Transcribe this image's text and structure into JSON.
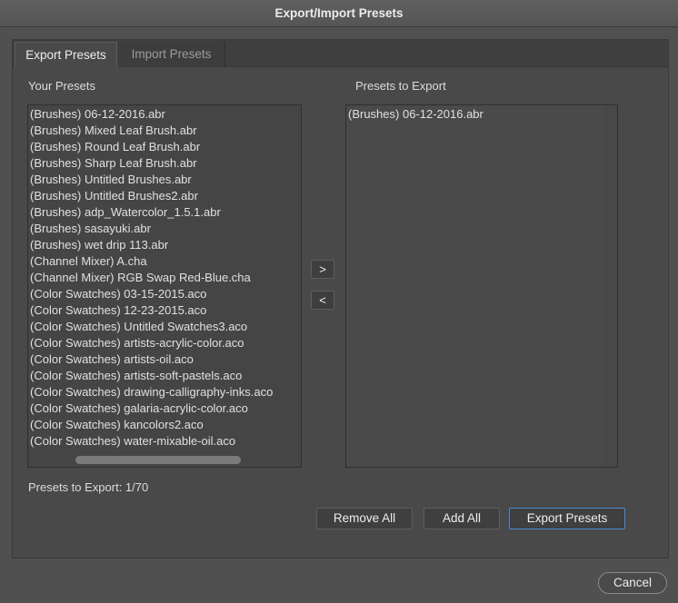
{
  "window": {
    "title": "Export/Import Presets"
  },
  "tabs": [
    {
      "label": "Export Presets",
      "active": true
    },
    {
      "label": "Import Presets",
      "active": false
    }
  ],
  "left_panel": {
    "label": "Your Presets",
    "items": [
      "(Brushes)  06-12-2016.abr",
      "(Brushes)  Mixed Leaf Brush.abr",
      "(Brushes)  Round Leaf Brush.abr",
      "(Brushes)  Sharp Leaf Brush.abr",
      "(Brushes)  Untitled Brushes.abr",
      "(Brushes)  Untitled Brushes2.abr",
      "(Brushes)  adp_Watercolor_1.5.1.abr",
      "(Brushes)  sasayuki.abr",
      "(Brushes)  wet drip 113.abr",
      "(Channel Mixer)  A.cha",
      "(Channel Mixer)  RGB Swap Red-Blue.cha",
      "(Color Swatches)  03-15-2015.aco",
      "(Color Swatches)  12-23-2015.aco",
      "(Color Swatches)  Untitled Swatches3.aco",
      "(Color Swatches)  artists-acrylic-color.aco",
      "(Color Swatches)  artists-oil.aco",
      "(Color Swatches)  artists-soft-pastels.aco",
      "(Color Swatches)  drawing-calligraphy-inks.aco",
      "(Color Swatches)  galaria-acrylic-color.aco",
      "(Color Swatches)  kancolors2.aco",
      "(Color Swatches)  water-mixable-oil.aco"
    ]
  },
  "right_panel": {
    "label": "Presets to Export",
    "items": [
      "(Brushes)  06-12-2016.abr"
    ]
  },
  "transfer": {
    "add_label": ">",
    "remove_label": "<"
  },
  "status": {
    "text": "Presets to Export: 1/70"
  },
  "buttons": {
    "remove_all": "Remove All",
    "add_all": "Add All",
    "export": "Export Presets",
    "cancel": "Cancel"
  },
  "colors": {
    "background": "#505050",
    "panel": "#494949",
    "accent_focus": "#4a8ad8"
  }
}
